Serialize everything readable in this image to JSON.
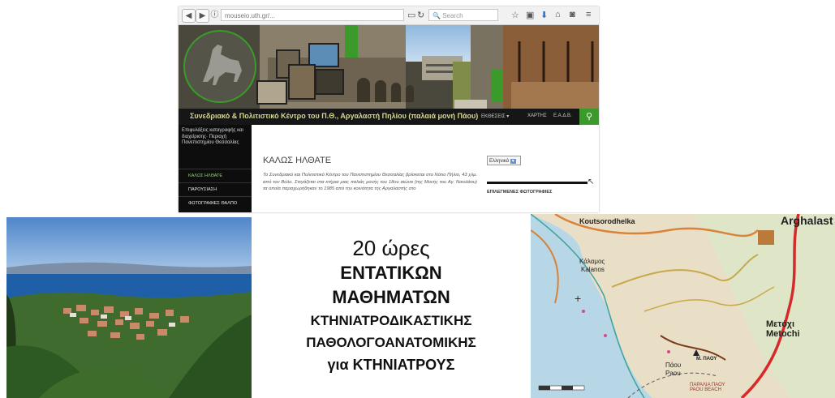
{
  "browser": {
    "url": "mouseio.uth.gr/...",
    "search_placeholder": "Search"
  },
  "website": {
    "site_title": "Συνεδριακό & Πολιτιστικό Κέντρο του Π.Θ., Αργαλαστή Πηλίου (παλαιά μονή Πάου)",
    "nav": {
      "events": "ΕΚΘΕΣΕΙΣ ▾",
      "maps": "ΧΑΡΤΗΣ",
      "eadb": "Ε.Α.Δ.Β."
    },
    "sidebar": {
      "description": "Επιφυλάξεις καταγραφής και διαχείρισης· Περιοχή Πανεπιστημίου Θεσσαλίας",
      "items": [
        "ΚΑΛΩΣ ΗΛΘΑΤΕ",
        "ΠΑΡΟΥΣΙΑΣΗ",
        "ΦΩΤΟΓΡΑΦΙΕΣ ΘΑΛΠΟ"
      ]
    },
    "main": {
      "heading": "ΚΑΛΩΣ ΗΛΘΑΤΕ",
      "text": "Το Συνεδριακό και Πολιτιστικό Κέντρο του Πανεπιστημίου Θεσσαλίας βρίσκεται στο Νότιο Πήλιο, 43 χλμ. από τον Βόλο. Στεγάζεται στα κτήρια μιας παλιάς μονής του 18ου αιώνα (της Μονής του Αγ. Νικολάου) τα οποία παραχωρήθηκαν το 1985 από την κοινότητα της Αργαλαστής στο"
    },
    "right": {
      "language": "Ελληνικά",
      "featured_photos": "ΕΠΙΛΕΓΜΕΝΕΣ ΦΩΤΟΓΡΑΦΙΕΣ"
    }
  },
  "title_block": {
    "line1": "20 ώρες",
    "line2": "ΕΝΤΑΤΙΚΩΝ",
    "line3": "ΜΑΘΗΜΑΤΩΝ",
    "line4": "ΚΤΗΝΙΑΤΡΟΔΙΚΑΣΤΙΚΗΣ",
    "line5": "ΠΑΘΟΛΟΓΟΑΝΑΤΟΜΙΚΗΣ",
    "line6": "για ΚΤΗΝΙΑΤΡΟΥΣ"
  },
  "map": {
    "labels": {
      "argalasti": "Arghalast",
      "koutsorodhelka": "Koutsorodhelka",
      "kalamos_gr": "Κάλαμος",
      "kalamos": "Kalanos",
      "metochi_gr": "Μετόχι",
      "metochi": "Metochi",
      "paou_gr": "Πάου",
      "paou": "Paou",
      "monastery": "Μ. ΠΑΟΥ",
      "beach": "ΠΑΡΑΛΙΑ ΠΑΟΥ\nPAOU BEACH"
    }
  },
  "colors": {
    "green": "#3a9a2a",
    "dark": "#161616"
  }
}
